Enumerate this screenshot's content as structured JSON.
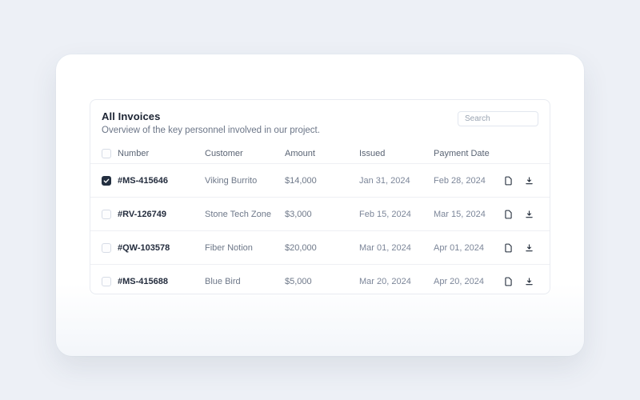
{
  "panel": {
    "title": "All Invoices",
    "subtitle": "Overview of the key personnel involved in our project.",
    "search": {
      "placeholder": "Search"
    },
    "table": {
      "columns": [
        "Number",
        "Customer",
        "Amount",
        "Issued",
        "Payment Date"
      ],
      "rows": [
        {
          "checked": true,
          "number": "#MS-415646",
          "customer": "Viking Burrito",
          "amount": "$14,000",
          "issued": "Jan 31, 2024",
          "payment_date": "Feb 28, 2024"
        },
        {
          "checked": false,
          "number": "#RV-126749",
          "customer": "Stone Tech Zone",
          "amount": "$3,000",
          "issued": "Feb 15, 2024",
          "payment_date": "Mar 15, 2024"
        },
        {
          "checked": false,
          "number": "#QW-103578",
          "customer": "Fiber Notion",
          "amount": "$20,000",
          "issued": "Mar 01, 2024",
          "payment_date": "Apr 01, 2024"
        },
        {
          "checked": false,
          "number": "#MS-415688",
          "customer": "Blue Bird",
          "amount": "$5,000",
          "issued": "Mar 20, 2024",
          "payment_date": "Apr 20, 2024"
        }
      ],
      "row_icons": [
        "document-icon",
        "download-icon"
      ]
    }
  },
  "colors": {
    "page_background": "#edf0f6",
    "card_background": "#ffffff",
    "panel_border": "#e8ebf1",
    "row_divider": "#eef0f4",
    "title_text": "#1c2433",
    "muted_text": "#6b7587",
    "checkbox_checked": "#232f40",
    "icon_color": "#1f2937"
  }
}
